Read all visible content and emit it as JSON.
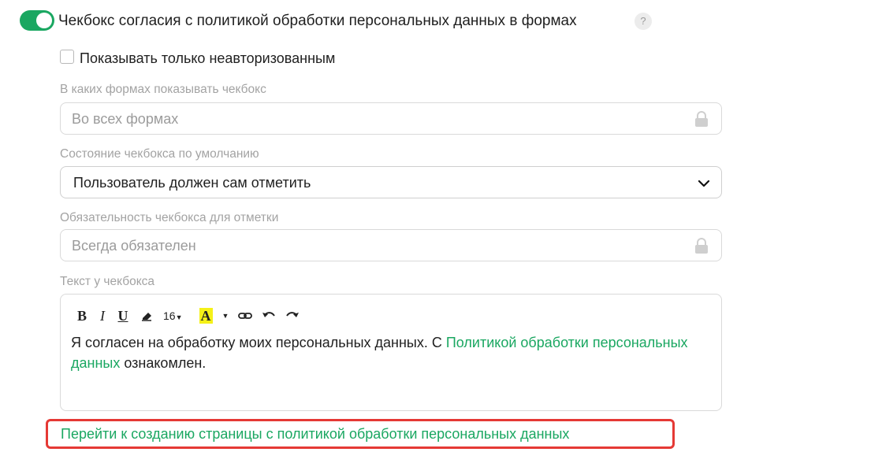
{
  "consent": {
    "label": "Чекбокс согласия с политикой обработки персональных данных в формах",
    "help": "?",
    "enabled": true,
    "toggle_color": "#1aa761"
  },
  "only_unauthorized": {
    "label": "Показывать только неавторизованным",
    "checked": false
  },
  "forms": {
    "label": "В каких формах показывать чекбокс",
    "value": "Во всех формах"
  },
  "default_state": {
    "label": "Состояние чекбокса по умолчанию",
    "value": "Пользователь должен сам отметить"
  },
  "required": {
    "label": "Обязательность чекбокса для отметки",
    "value": "Всегда обязателен"
  },
  "checkbox_text": {
    "label": "Текст у чекбокса",
    "toolbar": {
      "bold": "B",
      "italic": "I",
      "underline": "U",
      "font_size": "16",
      "text_color": "A"
    },
    "text_before": "Я согласен на обработку моих персональных данных. С ",
    "link_text": "Политикой обработки персональных данных",
    "text_after": " ознакомлен."
  },
  "create_page_link": "Перейти к созданию страницы с политикой обработки персональных данных",
  "colors": {
    "accent": "#1aa761",
    "highlight_border": "#e53935",
    "muted_text": "#a3a3a3"
  }
}
